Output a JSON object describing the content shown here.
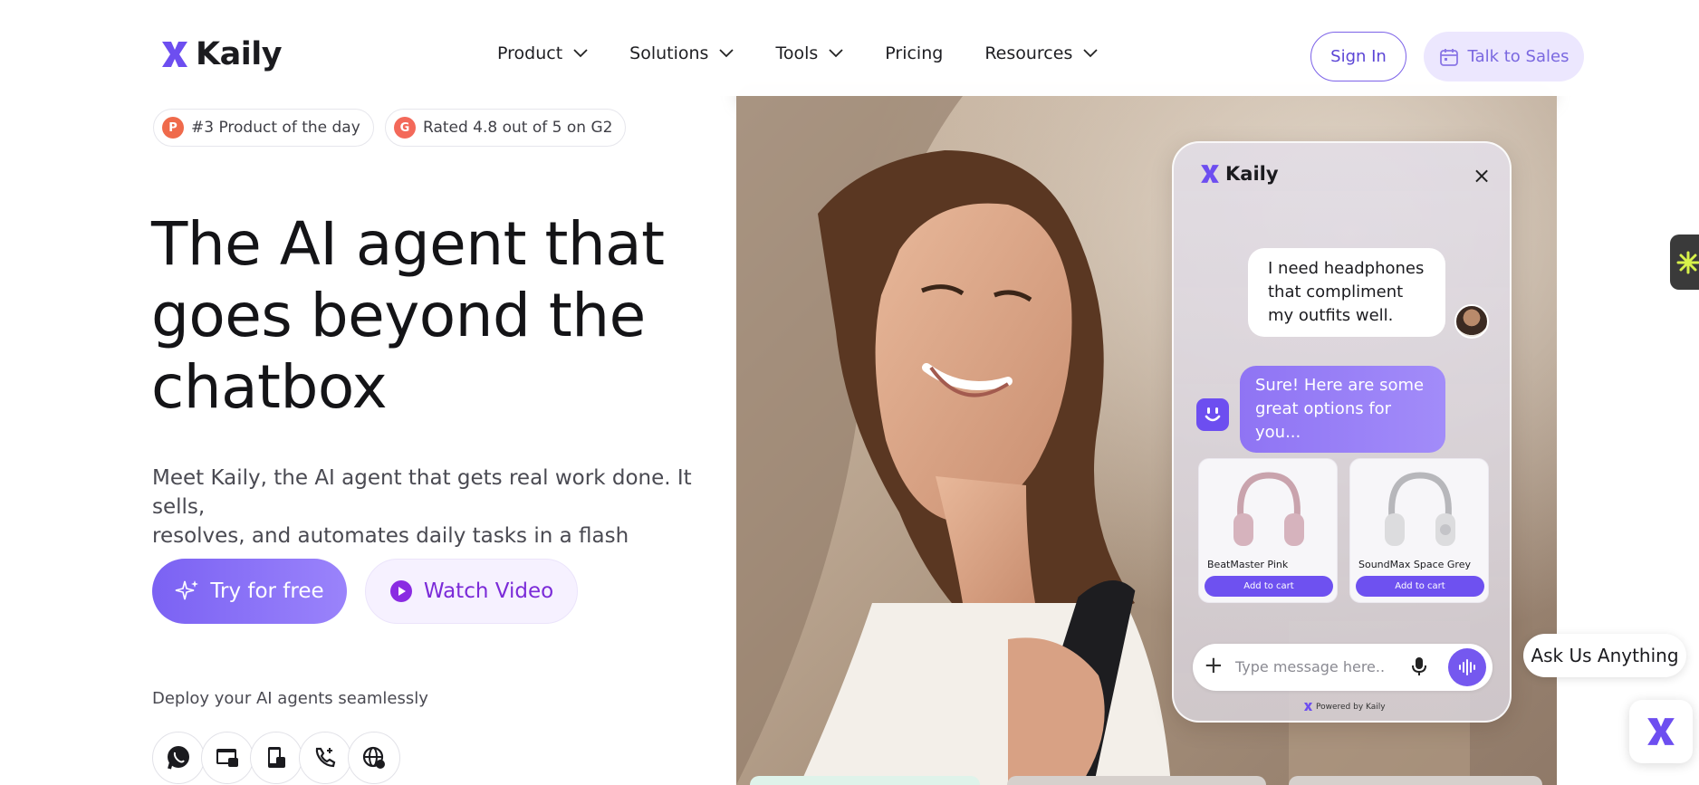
{
  "brand": {
    "name": "Kaily",
    "accent": "#6d4ef0",
    "accent_light": "#ece7fe"
  },
  "nav": {
    "items": [
      {
        "label": "Product",
        "has_dropdown": true
      },
      {
        "label": "Solutions",
        "has_dropdown": true
      },
      {
        "label": "Tools",
        "has_dropdown": true
      },
      {
        "label": "Pricing",
        "has_dropdown": false
      },
      {
        "label": "Resources",
        "has_dropdown": true
      }
    ],
    "sign_in": "Sign In",
    "talk_to_sales": "Talk to Sales",
    "talk_icon": "calendar-icon"
  },
  "badges": [
    {
      "icon": "producthunt-icon",
      "letter": "P",
      "color": "#ef6a4b",
      "label": "#3 Product of the day"
    },
    {
      "icon": "g2-icon",
      "letter": "G",
      "color": "#f3695a",
      "label": "Rated 4.8 out of 5 on G2"
    }
  ],
  "hero": {
    "title_lines": [
      "The AI agent that",
      "goes beyond the",
      "chatbox"
    ],
    "subtitle_lines": [
      "Meet Kaily, the AI agent that gets real work done. It sells,",
      "resolves, and automates daily tasks in a flash"
    ],
    "primary_cta": "Try for free",
    "secondary_cta": "Watch Video",
    "deploy_label": "Deploy your AI agents seamlessly",
    "channels": [
      "whatsapp-icon",
      "web-widget-icon",
      "mobile-app-icon",
      "phone-call-icon",
      "globe-icon"
    ]
  },
  "chat_widget": {
    "brand": "Kaily",
    "close": "×",
    "user_message": "I need headphones that compliment my outfits well.",
    "bot_message": "Sure! Here are some great options for you...",
    "products": [
      {
        "name": "BeatMaster Pink",
        "button": "Add to cart",
        "color": "#d9bcc4"
      },
      {
        "name": "SoundMax Space Grey",
        "button": "Add to cart",
        "color": "#d8d8db"
      }
    ],
    "input_placeholder": "Type message here..",
    "powered_by": "Powered by Kaily"
  },
  "floaters": {
    "ask_label": "Ask Us Anything",
    "side_tab_icon": "sparkle-icon",
    "fab_icon": "kaily-logo-icon"
  }
}
